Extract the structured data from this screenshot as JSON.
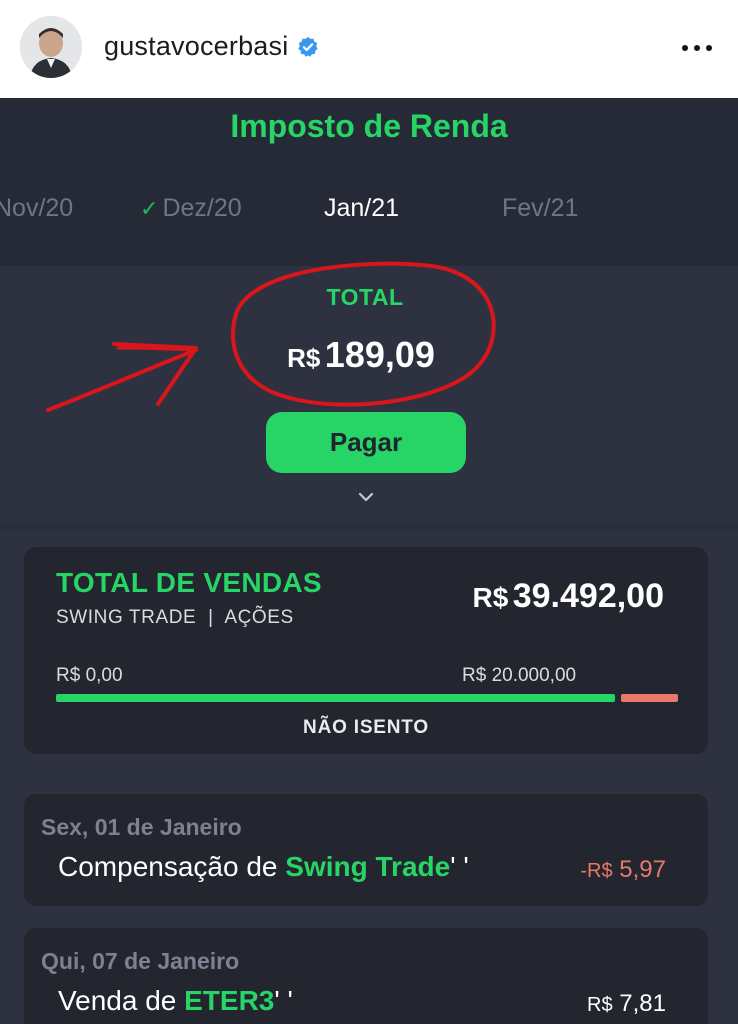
{
  "post_header": {
    "username": "gustavocerbasi",
    "verified": true,
    "more_icon": "more-horizontal-icon"
  },
  "app": {
    "title": "Imposto de Renda",
    "months": [
      {
        "label": "Nov/20",
        "paid": false,
        "active": false
      },
      {
        "label": "Dez/20",
        "paid": true,
        "active": false
      },
      {
        "label": "Jan/21",
        "paid": false,
        "active": true
      },
      {
        "label": "Fev/21",
        "paid": false,
        "active": false
      }
    ],
    "total": {
      "label": "TOTAL",
      "currency": "R$",
      "amount": "189,09"
    },
    "pay_button": "Pagar",
    "expand_icon": "chevron-down-icon"
  },
  "vendas": {
    "title": "TOTAL DE VENDAS",
    "subtitle": "SWING TRADE  |  AÇÕES",
    "currency": "R$",
    "amount": "39.492,00",
    "range_min": "R$ 0,00",
    "range_max": "R$ 20.000,00",
    "status": "NÃO ISENTO",
    "colors": {
      "within": "#27d566",
      "excess": "#e8786a"
    }
  },
  "transactions": [
    {
      "date": "Sex, 01 de Janeiro",
      "prefix": "Compensação de ",
      "highlight": "Swing Trade",
      "suffix": "' '",
      "amount_prefix": "-R$",
      "amount": "5,97",
      "negative": true
    },
    {
      "date": "Qui, 07 de Janeiro",
      "prefix": "Venda de ",
      "highlight": "ETER3",
      "suffix": "' '",
      "amount_prefix": "R$",
      "amount": "7,81",
      "negative": false
    }
  ],
  "annotation": {
    "shapes": [
      "red-circle",
      "red-arrow"
    ],
    "color": "#d8161c"
  }
}
